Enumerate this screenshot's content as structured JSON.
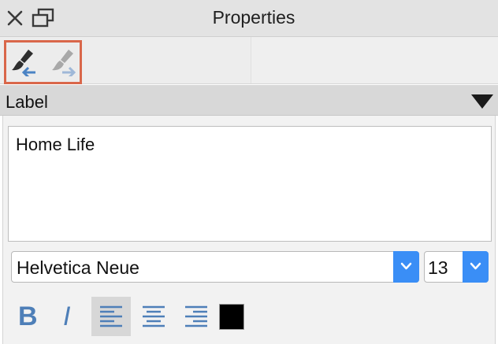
{
  "window": {
    "title": "Properties"
  },
  "toolbar": {
    "copy_style_icon": "paintbrush-copy-icon",
    "paste_style_icon": "paintbrush-paste-icon"
  },
  "section": {
    "label": "Label"
  },
  "label_editor": {
    "value": "Home Life"
  },
  "font": {
    "family": "Helvetica Neue",
    "size": "13"
  },
  "format": {
    "bold_label": "B",
    "italic_label": "I",
    "alignment": "left",
    "text_color": "#000000"
  },
  "colors": {
    "accent": "#3a8ef6",
    "format_icon": "#4e7fb8",
    "highlight_border": "#d9674a"
  }
}
